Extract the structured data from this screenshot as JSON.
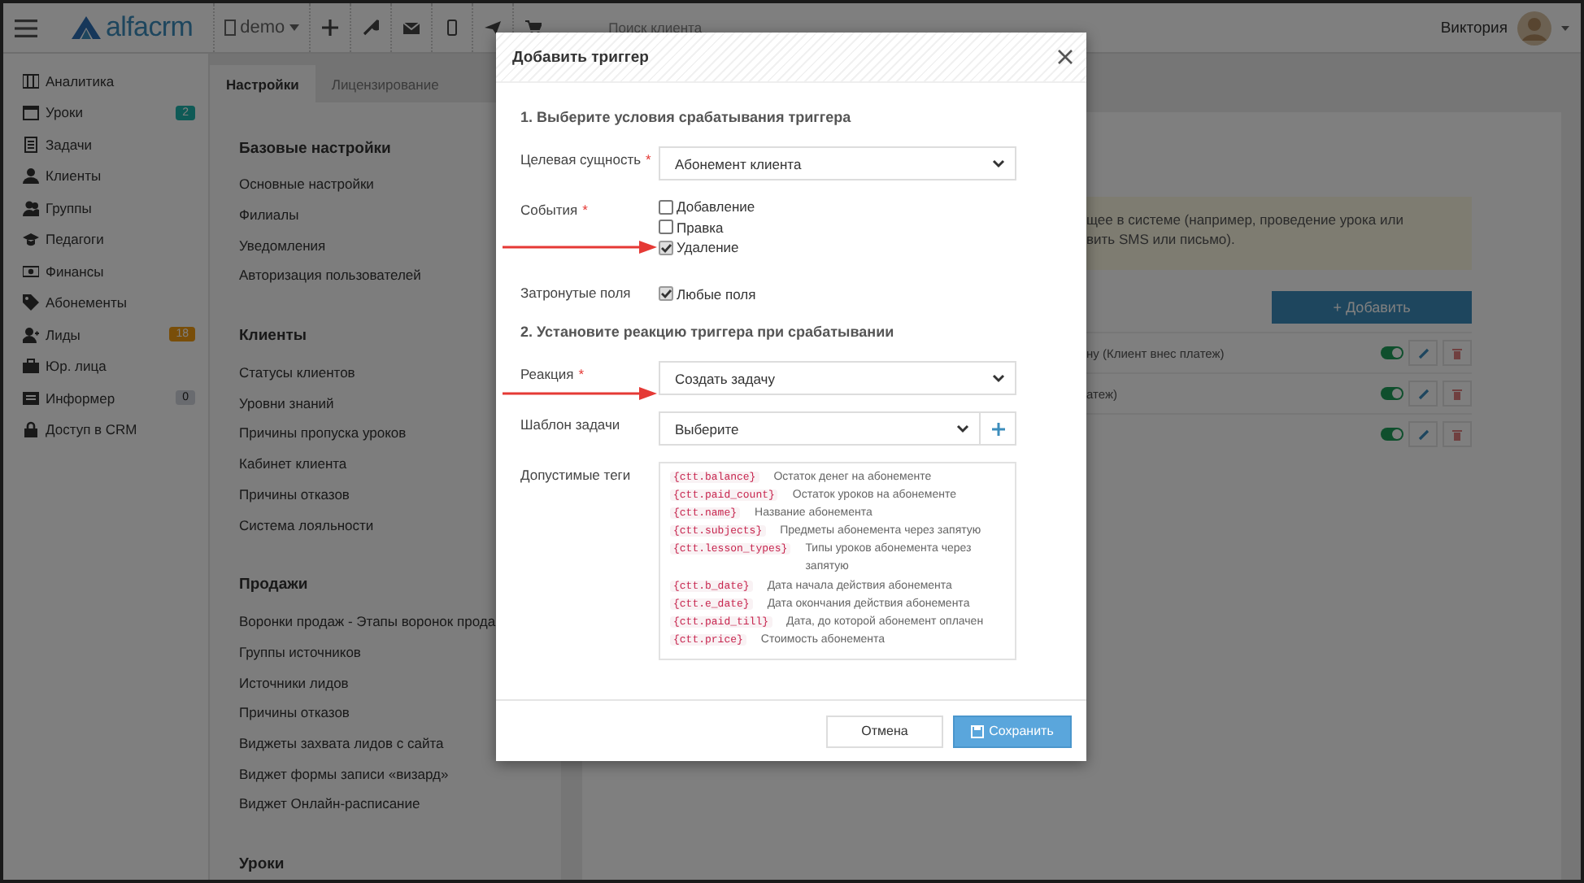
{
  "topbar": {
    "logo": "alfacrm",
    "branch": "demo",
    "search": {
      "placeholder": "Поиск клиента"
    },
    "user": {
      "name": "Виктория"
    }
  },
  "sidebar": {
    "items": [
      {
        "label": "Аналитика"
      },
      {
        "label": "Уроки",
        "badge": "2",
        "kind": "info"
      },
      {
        "label": "Задачи"
      },
      {
        "label": "Клиенты"
      },
      {
        "label": "Группы"
      },
      {
        "label": "Педагоги"
      },
      {
        "label": "Финансы"
      },
      {
        "label": "Абонементы"
      },
      {
        "label": "Лиды",
        "badge": "18",
        "kind": "warning"
      },
      {
        "label": "Юр. лица"
      },
      {
        "label": "Информер",
        "badge": "0",
        "kind": "neutral"
      },
      {
        "label": "Доступ в CRM"
      }
    ]
  },
  "settings": {
    "tabs": [
      {
        "label": "Настройки",
        "selected": true
      },
      {
        "label": "Лицензирование",
        "selected": false
      }
    ],
    "sections": [
      {
        "title": "Базовые настройки",
        "items": [
          "Основные настройки",
          "Филиалы",
          "Уведомления",
          "Авторизация пользователей"
        ]
      },
      {
        "title": "Клиенты",
        "items": [
          "Статусы клиентов",
          "Уровни знаний",
          "Причины пропуска уроков",
          "Кабинет клиента",
          "Причины отказов",
          "Система лояльности"
        ]
      },
      {
        "title": "Продажи",
        "items": [
          "Воронки продаж - Этапы воронок прода",
          "Группы источников",
          "Источники лидов",
          "Причины отказов",
          "Виджеты захвата лидов с сайта",
          "Виджет формы записи «визард»",
          "Виджет Онлайн-расписание"
        ]
      },
      {
        "title": "Уроки"
      }
    ]
  },
  "panel": {
    "alert": [
      "щее в системе (например, проведение урока или",
      "вить SMS или письмо)."
    ],
    "add_button": "+ Добавить",
    "rows": [
      {
        "text": "ну (Клиент внес платеж)",
        "on": true
      },
      {
        "text": "атеж)",
        "on": true
      },
      {
        "on": true
      }
    ]
  },
  "modal": {
    "title": "Добавить триггер",
    "section_1": "1. Выберите условия срабатывания триггера",
    "target": {
      "label": "Целевая сущность",
      "asterisk": "*",
      "value": "Абонемент клиента"
    },
    "events": {
      "label": "События",
      "asterisk": "*",
      "options": [
        {
          "label": "Добавление",
          "checked": false,
          "arrow": false
        },
        {
          "label": "Правка",
          "checked": false,
          "arrow": false
        },
        {
          "label": "Удаление",
          "checked": true,
          "arrow": true
        }
      ]
    },
    "affected_fields": {
      "label": "Затронутые поля",
      "options": [
        {
          "label": "Любые поля",
          "checked": true,
          "arrow": false
        }
      ]
    },
    "section_2": "2. Установите реакцию триггера при срабатывании",
    "reaction": {
      "label": "Реакция",
      "asterisk": "*",
      "value": "Создать задачу",
      "arrow": true
    },
    "template": {
      "label": "Шаблон задачи",
      "value": "Выберите",
      "arrow": false
    },
    "tags": {
      "label": "Допустимые теги",
      "items": [
        {
          "code": "{ctt.balance}",
          "description": "Остаток денег на абонементе"
        },
        {
          "code": "{ctt.paid_count}",
          "description": "Остаток уроков на абонементе"
        },
        {
          "code": "{ctt.name}",
          "description": "Название абонемента"
        },
        {
          "code": "{ctt.subjects}",
          "description": "Предметы абонемента через запятую"
        },
        {
          "code": "{ctt.lesson_types}",
          "description": "Типы уроков абонемента через запятую"
        },
        {
          "code": "{ctt.b_date}",
          "description": "Дата начала действия абонемента"
        },
        {
          "code": "{ctt.e_date}",
          "description": "Дата окончания действия абонемента"
        },
        {
          "code": "{ctt.paid_till}",
          "description": "Дата, до которой абонемент оплачен"
        },
        {
          "code": "{ctt.price}",
          "description": "Стоимость абонемента"
        }
      ]
    },
    "buttons": {
      "cancel": "Отмена",
      "save": "Сохранить"
    }
  }
}
